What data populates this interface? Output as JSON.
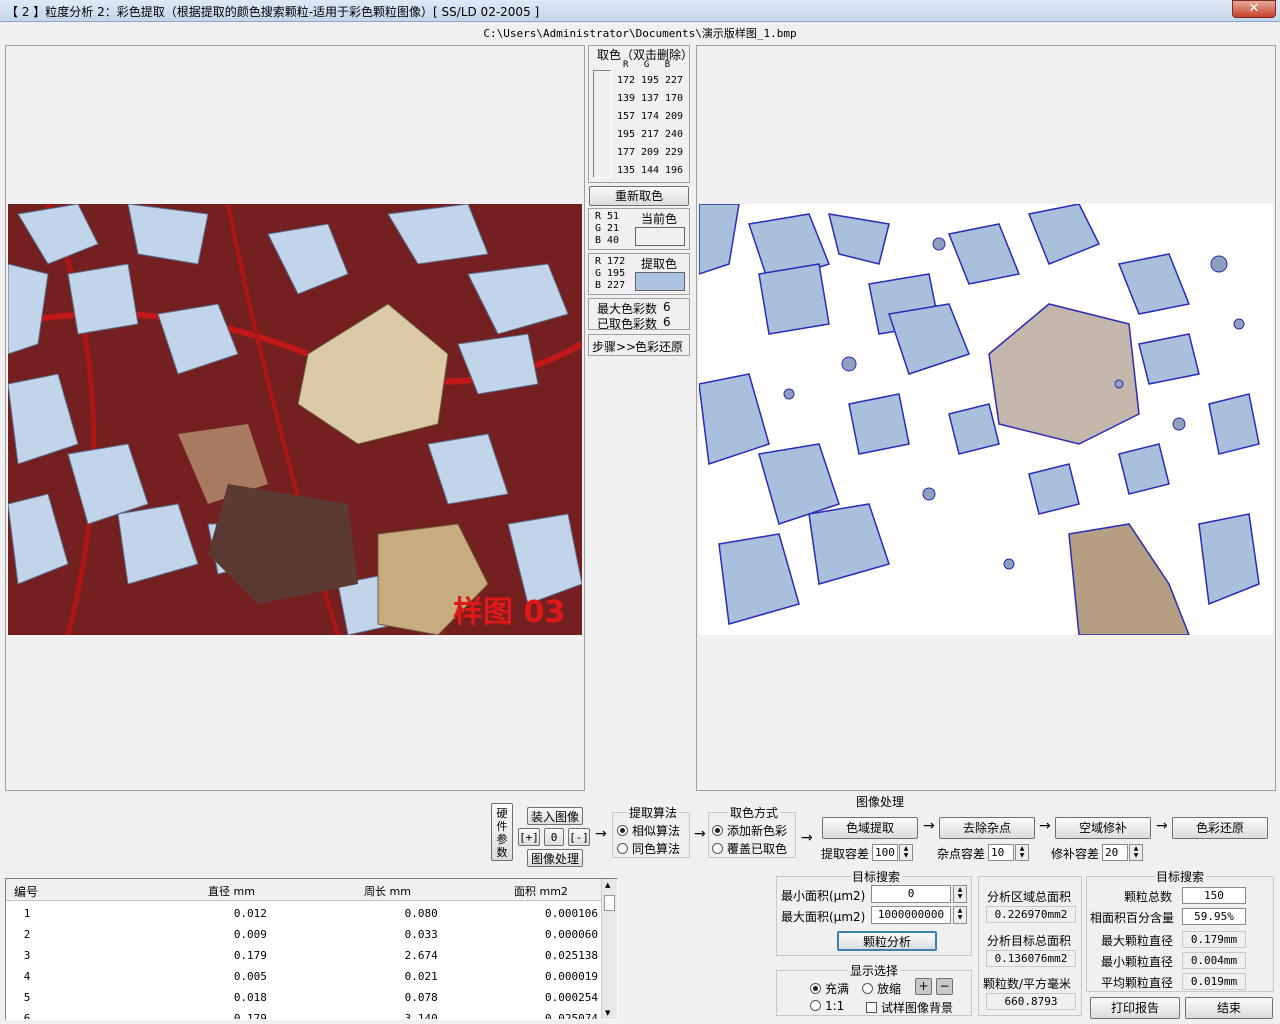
{
  "window": {
    "title": "【 2 】粒度分析 2：彩色提取（根据提取的颜色搜索颗粒-适用于彩色颗粒图像）[  SS/LD 02-2005  ]",
    "close_label": "✕"
  },
  "path": "C:\\Users\\Administrator\\Documents\\演示版样图_1.bmp",
  "color_pick": {
    "title": "取色（双击删除）",
    "headers": [
      "R",
      "G",
      "B"
    ],
    "rows": [
      [
        "172",
        "195",
        "227"
      ],
      [
        "139",
        "137",
        "170"
      ],
      [
        "157",
        "174",
        "209"
      ],
      [
        "195",
        "217",
        "240"
      ],
      [
        "177",
        "209",
        "229"
      ],
      [
        "135",
        "144",
        "196"
      ]
    ],
    "reset_label": "重新取色"
  },
  "current_color": {
    "label": "当前色",
    "r": "R  51",
    "g": "G  21",
    "b": "B  40",
    "hex": "#f0f0f0"
  },
  "extract_color": {
    "label": "提取色",
    "r": "R  172",
    "g": "G  195",
    "b": "B  227",
    "hex": "#acc3e3"
  },
  "color_counts": {
    "max_label": "最大色彩数",
    "max_value": "6",
    "taken_label": "已取色彩数",
    "taken_value": "6"
  },
  "step": {
    "label": "步骤>>",
    "value": "色彩还原"
  },
  "image": {
    "watermark": "样图 03"
  },
  "controls": {
    "hw_label": "硬件参数",
    "load_label": "装入图像",
    "plus_label": "[+]",
    "zero_label": "0",
    "minus_label": "[-]",
    "process_label": "图像处理",
    "algo_title": "提取算法",
    "algo_opt1": "相似算法",
    "algo_opt2": "同色算法",
    "pick_title": "取色方式",
    "pick_opt1": "添加新色彩",
    "pick_opt2": "覆盖已取色",
    "img_proc_title": "图像处理",
    "b_extract": "色域提取",
    "b_noise": "去除杂点",
    "b_fill": "空域修补",
    "b_restore": "色彩还原",
    "tol_label": "提取容差",
    "tol_value": "100",
    "noise_label": "杂点容差",
    "noise_value": "10",
    "fix_label": "修补容差",
    "fix_value": "20"
  },
  "table": {
    "headers": [
      "编号",
      "直径 mm",
      "周长 mm",
      "面积 mm2"
    ],
    "rows": [
      [
        "1",
        "0.012",
        "0.080",
        "0.000106"
      ],
      [
        "2",
        "0.009",
        "0.033",
        "0.000060"
      ],
      [
        "3",
        "0.179",
        "2.674",
        "0.025138"
      ],
      [
        "4",
        "0.005",
        "0.021",
        "0.000019"
      ],
      [
        "5",
        "0.018",
        "0.078",
        "0.000254"
      ],
      [
        "6",
        "0.179",
        "3.140",
        "0.025074"
      ]
    ]
  },
  "search": {
    "title": "目标搜索",
    "min_label": "最小面积(μm2)",
    "min_value": "0",
    "max_label": "最大面积(μm2)",
    "max_value": "1000000000",
    "analyze_label": "颗粒分析"
  },
  "display": {
    "title": "显示选择",
    "opt_fill": "充满",
    "opt_zoom": "放缩",
    "opt_11": "1:1",
    "opt_bg": "试样图像背景",
    "plus": "+",
    "minus": "−"
  },
  "area": {
    "total_label": "分析区域总面积",
    "total_value": "0.226970mm2",
    "target_label": "分析目标总面积",
    "target_value": "0.136076mm2",
    "density_label": "颗粒数/平方毫米",
    "density_value": "660.8793"
  },
  "results": {
    "title": "目标搜索",
    "count_label": "颗粒总数",
    "count_value": "150",
    "pct_label": "相面积百分含量",
    "pct_value": "59.95%",
    "max_label": "最大颗粒直径",
    "max_value": "0.179mm",
    "min_label": "最小颗粒直径",
    "min_value": "0.004mm",
    "avg_label": "平均颗粒直径",
    "avg_value": "0.019mm"
  },
  "footer": {
    "print_label": "打印报告",
    "end_label": "结束"
  }
}
